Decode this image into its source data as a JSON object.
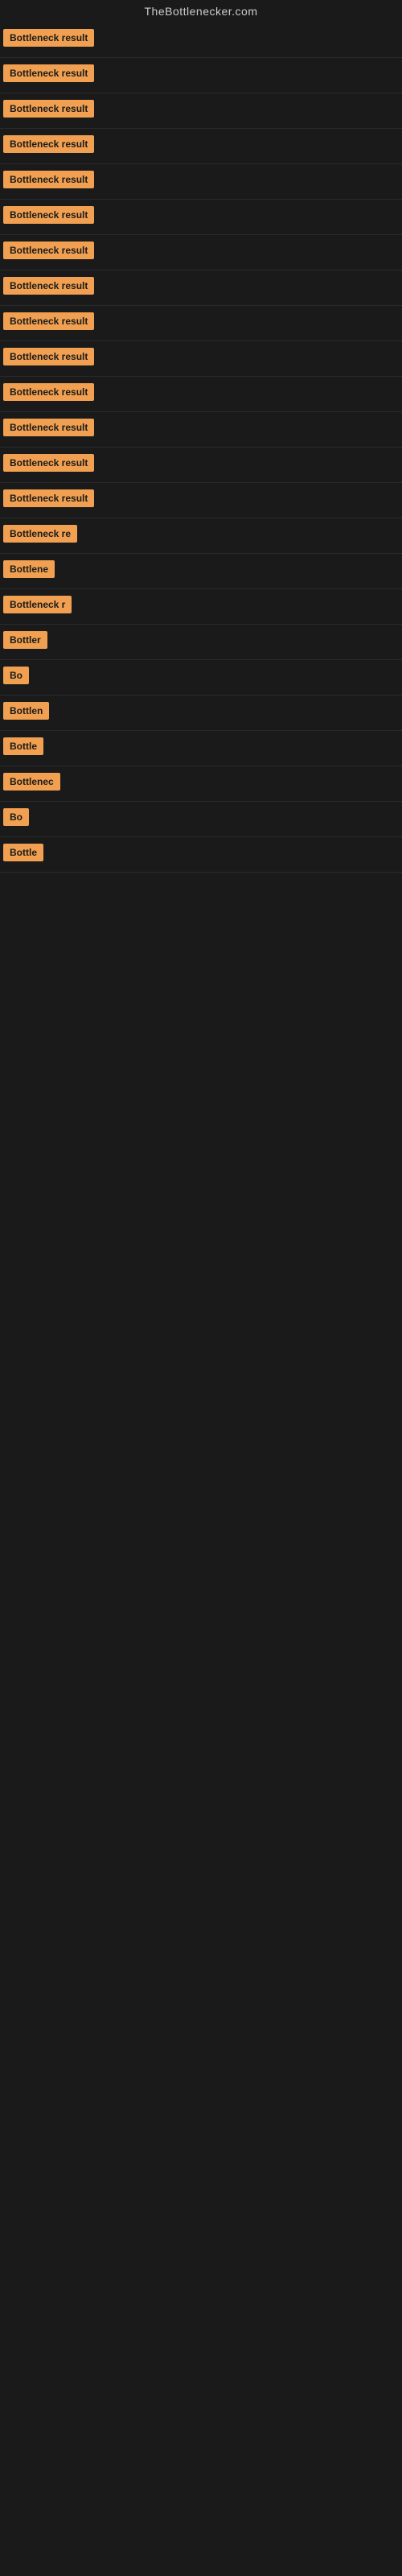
{
  "site": {
    "title": "TheBottlenecker.com"
  },
  "rows": [
    {
      "id": 1,
      "label": "Bottleneck result",
      "visible_chars": 17
    },
    {
      "id": 2,
      "label": "Bottleneck result",
      "visible_chars": 17
    },
    {
      "id": 3,
      "label": "Bottleneck result",
      "visible_chars": 17
    },
    {
      "id": 4,
      "label": "Bottleneck result",
      "visible_chars": 17
    },
    {
      "id": 5,
      "label": "Bottleneck result",
      "visible_chars": 17
    },
    {
      "id": 6,
      "label": "Bottleneck result",
      "visible_chars": 17
    },
    {
      "id": 7,
      "label": "Bottleneck result",
      "visible_chars": 17
    },
    {
      "id": 8,
      "label": "Bottleneck result",
      "visible_chars": 17
    },
    {
      "id": 9,
      "label": "Bottleneck result",
      "visible_chars": 17
    },
    {
      "id": 10,
      "label": "Bottleneck result",
      "visible_chars": 17
    },
    {
      "id": 11,
      "label": "Bottleneck result",
      "visible_chars": 17
    },
    {
      "id": 12,
      "label": "Bottleneck result",
      "visible_chars": 17
    },
    {
      "id": 13,
      "label": "Bottleneck result",
      "visible_chars": 17
    },
    {
      "id": 14,
      "label": "Bottleneck result",
      "visible_chars": 17
    },
    {
      "id": 15,
      "label": "Bottleneck re",
      "visible_chars": 13
    },
    {
      "id": 16,
      "label": "Bottlene",
      "visible_chars": 8
    },
    {
      "id": 17,
      "label": "Bottleneck r",
      "visible_chars": 12
    },
    {
      "id": 18,
      "label": "Bottler",
      "visible_chars": 7
    },
    {
      "id": 19,
      "label": "Bo",
      "visible_chars": 2
    },
    {
      "id": 20,
      "label": "Bottlen",
      "visible_chars": 7
    },
    {
      "id": 21,
      "label": "Bottle",
      "visible_chars": 6
    },
    {
      "id": 22,
      "label": "Bottlenec",
      "visible_chars": 9
    },
    {
      "id": 23,
      "label": "Bo",
      "visible_chars": 2
    },
    {
      "id": 24,
      "label": "Bottle",
      "visible_chars": 6
    }
  ],
  "colors": {
    "badge_bg": "#f0a050",
    "badge_text": "#1a1a1a",
    "background": "#1a1a1a",
    "title_color": "#cccccc"
  }
}
